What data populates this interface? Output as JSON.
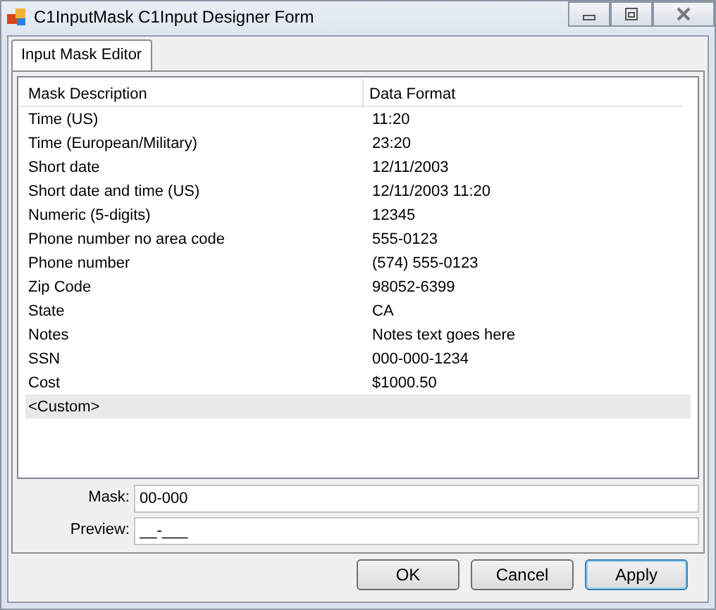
{
  "window": {
    "title": "C1InputMask C1Input Designer Form"
  },
  "tabs": [
    {
      "label": "Input Mask Editor",
      "selected": true
    }
  ],
  "table": {
    "columns": [
      "Mask Description",
      "Data Format"
    ],
    "rows": [
      {
        "cells": [
          "Time (US)",
          "11:20"
        ],
        "selected": false
      },
      {
        "cells": [
          "Time (European/Military)",
          "23:20"
        ],
        "selected": false
      },
      {
        "cells": [
          "Short date",
          "12/11/2003"
        ],
        "selected": false
      },
      {
        "cells": [
          "Short date and time (US)",
          "12/11/2003 11:20"
        ],
        "selected": false
      },
      {
        "cells": [
          "Numeric (5-digits)",
          "12345"
        ],
        "selected": false
      },
      {
        "cells": [
          "Phone number no area code",
          "555-0123"
        ],
        "selected": false
      },
      {
        "cells": [
          "Phone number",
          "(574) 555-0123"
        ],
        "selected": false
      },
      {
        "cells": [
          "Zip Code",
          "98052-6399"
        ],
        "selected": false
      },
      {
        "cells": [
          "State",
          "CA"
        ],
        "selected": false
      },
      {
        "cells": [
          "Notes",
          "Notes text goes here"
        ],
        "selected": false
      },
      {
        "cells": [
          "SSN",
          "000-000-1234"
        ],
        "selected": false
      },
      {
        "cells": [
          "Cost",
          "$1000.50"
        ],
        "selected": false
      },
      {
        "cells": [
          "<Custom>",
          ""
        ],
        "selected": true
      }
    ]
  },
  "fields": [
    {
      "label": "Mask:",
      "value": "00-000"
    },
    {
      "label": "Preview:",
      "value": "__-___"
    }
  ],
  "buttons": [
    {
      "label": "OK",
      "default": false
    },
    {
      "label": "Cancel",
      "default": false
    },
    {
      "label": "Apply",
      "default": true
    }
  ]
}
